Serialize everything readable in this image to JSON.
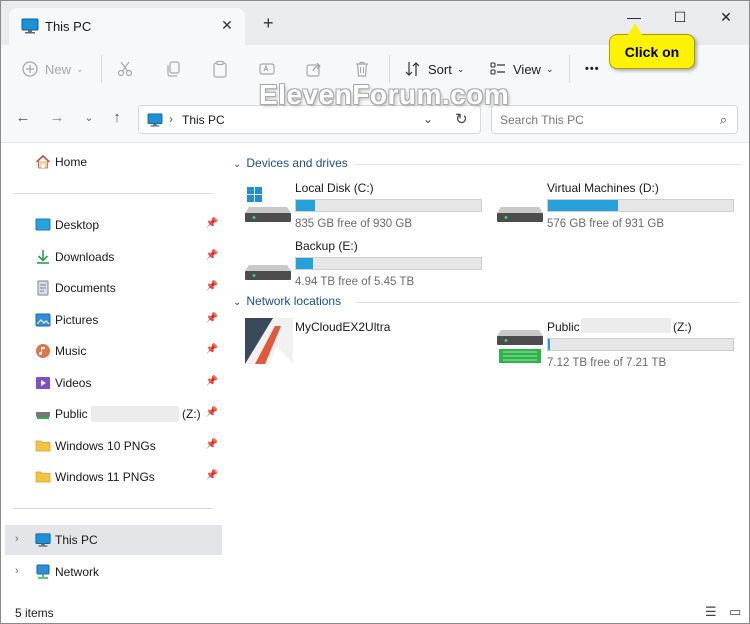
{
  "window": {
    "tab_title": "This PC",
    "tab_close": "✕",
    "new_tab": "+",
    "minimize": "—",
    "maximize": "☐",
    "close": "✕"
  },
  "toolbar": {
    "new_label": "New",
    "sort_label": "Sort",
    "view_label": "View",
    "more_label": "•••"
  },
  "address": {
    "crumb": "This PC",
    "search_placeholder": "Search This PC"
  },
  "sidebar": {
    "home": "Home",
    "quick_access": [
      {
        "label": "Desktop",
        "icon": "desktop-icon"
      },
      {
        "label": "Downloads",
        "icon": "downloads-icon"
      },
      {
        "label": "Documents",
        "icon": "documents-icon"
      },
      {
        "label": "Pictures",
        "icon": "pictures-icon"
      },
      {
        "label": "Music",
        "icon": "music-icon"
      },
      {
        "label": "Videos",
        "icon": "videos-icon"
      },
      {
        "label": "Public",
        "icon": "network-drive-icon",
        "suffix": "(Z:)"
      },
      {
        "label": "Windows 10 PNGs",
        "icon": "folder-icon"
      },
      {
        "label": "Windows 11 PNGs",
        "icon": "folder-icon"
      }
    ],
    "this_pc": "This PC",
    "network": "Network"
  },
  "content": {
    "devices_header": "Devices and drives",
    "network_header": "Network locations",
    "drives": [
      {
        "name": "Local Disk (C:)",
        "free": "835 GB free of 930 GB",
        "used_fraction": 0.1
      },
      {
        "name": "Virtual Machines (D:)",
        "free": "576 GB free of 931 GB",
        "used_fraction": 0.38
      },
      {
        "name": "Backup (E:)",
        "free": "4.94 TB free of 5.45 TB",
        "used_fraction": 0.09
      }
    ],
    "network_items": [
      {
        "name": "MyCloudEX2Ultra"
      },
      {
        "name": "Public",
        "suffix": "(Z:)",
        "free": "7.12 TB free of 7.21 TB",
        "used_fraction": 0.012
      }
    ]
  },
  "status": {
    "count": "5 items"
  },
  "callout": {
    "text": "Click on"
  },
  "watermark": "ElevenForum.com",
  "colors": {
    "accent": "#26a0da",
    "callout": "#fff200",
    "group_header": "#1a4f8b"
  }
}
